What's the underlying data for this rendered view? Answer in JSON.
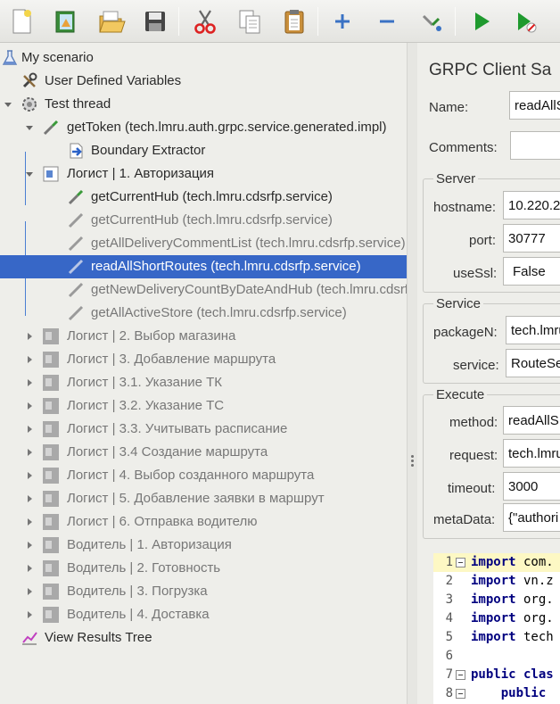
{
  "toolbar": {
    "buttons": [
      "new-icon",
      "templates-icon",
      "open-icon",
      "save-icon",
      "cut-icon",
      "copy-icon",
      "paste-icon",
      "expand-icon",
      "collapse-icon",
      "toggle-icon",
      "start-icon",
      "start-no-pauses-icon"
    ]
  },
  "tree": {
    "rows": [
      {
        "label": "My scenario",
        "icon": "flask-icon"
      },
      {
        "label": "User Defined Variables",
        "icon": "wrench-icon"
      },
      {
        "label": "Test thread",
        "icon": "gear-icon"
      },
      {
        "label": "getToken  (tech.lmru.auth.grpc.service.generated.impl)",
        "icon": "pipette-icon"
      },
      {
        "label": "Boundary Extractor",
        "icon": "extractor-icon"
      },
      {
        "label": "Логист | 1. Авторизация",
        "icon": "controller-icon"
      },
      {
        "label": "getCurrentHub  (tech.lmru.cdsrfp.service)",
        "icon": "pipette-icon"
      },
      {
        "label": "getCurrentHub  (tech.lmru.cdsrfp.service)",
        "icon": "pipette-disabled-icon"
      },
      {
        "label": "getAllDeliveryCommentList  (tech.lmru.cdsrfp.service)",
        "icon": "pipette-disabled-icon"
      },
      {
        "label": "readAllShortRoutes  (tech.lmru.cdsrfp.service)",
        "icon": "pipette-disabled-icon"
      },
      {
        "label": "getNewDeliveryCountByDateAndHub  (tech.lmru.cdsrfp.service)",
        "icon": "pipette-disabled-icon"
      },
      {
        "label": "getAllActiveStore  (tech.lmru.cdsrfp.service)",
        "icon": "pipette-disabled-icon"
      },
      {
        "label": "Логист | 2. Выбор магазина",
        "icon": "controller-disabled-icon"
      },
      {
        "label": "Логист | 3. Добавление маршрута",
        "icon": "controller-disabled-icon"
      },
      {
        "label": "Логист | 3.1. Указание ТК",
        "icon": "controller-disabled-icon"
      },
      {
        "label": "Логист | 3.2. Указание ТС",
        "icon": "controller-disabled-icon"
      },
      {
        "label": "Логист | 3.3. Учитывать расписание",
        "icon": "controller-disabled-icon"
      },
      {
        "label": "Логист | 3.4 Создание маршрута",
        "icon": "controller-disabled-icon"
      },
      {
        "label": "Логист | 4. Выбор созданного маршрута",
        "icon": "controller-disabled-icon"
      },
      {
        "label": "Логист | 5. Добавление заявки в маршрут",
        "icon": "controller-disabled-icon"
      },
      {
        "label": "Логист | 6. Отправка водителю",
        "icon": "controller-disabled-icon"
      },
      {
        "label": "Водитель | 1. Авторизация",
        "icon": "controller-disabled-icon"
      },
      {
        "label": "Водитель | 2. Готовность",
        "icon": "controller-disabled-icon"
      },
      {
        "label": "Водитель | 3. Погрузка",
        "icon": "controller-disabled-icon"
      },
      {
        "label": "Водитель | 4. Доставка",
        "icon": "controller-disabled-icon"
      },
      {
        "label": "View Results Tree",
        "icon": "results-tree-icon"
      }
    ]
  },
  "panel": {
    "title": "GRPC Client Sa",
    "name_label": "Name:",
    "name_value": "readAllS",
    "comments_label": "Comments:",
    "comments_value": "",
    "server_title": "Server",
    "hostname_label": "hostname:",
    "hostname_value": "10.220.2",
    "port_label": "port:",
    "port_value": "30777",
    "usessl_label": "useSsl:",
    "usessl_value": "False",
    "service_title": "Service",
    "package_label": "packageN:",
    "package_value": "tech.lmru",
    "service_label": "service:",
    "service_value": "RouteSe",
    "execute_title": "Execute",
    "method_label": "method:",
    "method_value": "readAllS",
    "request_label": "request:",
    "request_value": "tech.lmru",
    "timeout_label": "timeout:",
    "timeout_value": "3000",
    "metadata_label": "metaData:",
    "metadata_value": "{\"authori"
  },
  "code": {
    "lines": [
      {
        "num": "1",
        "kw": "import",
        "rest": " com."
      },
      {
        "num": "2",
        "kw": "import",
        "rest": " vn.z"
      },
      {
        "num": "3",
        "kw": "import",
        "rest": " org."
      },
      {
        "num": "4",
        "kw": "import",
        "rest": " org."
      },
      {
        "num": "5",
        "kw": "import",
        "rest": " tech"
      },
      {
        "num": "6",
        "kw": "",
        "rest": ""
      },
      {
        "num": "7",
        "kw": "public clas",
        "rest": ""
      },
      {
        "num": "8",
        "kw": "    public",
        "rest": ""
      }
    ]
  },
  "colors": {
    "selection": "#3767c7",
    "keyword": "#00007f",
    "highlight_line": "#fdf8c4"
  }
}
